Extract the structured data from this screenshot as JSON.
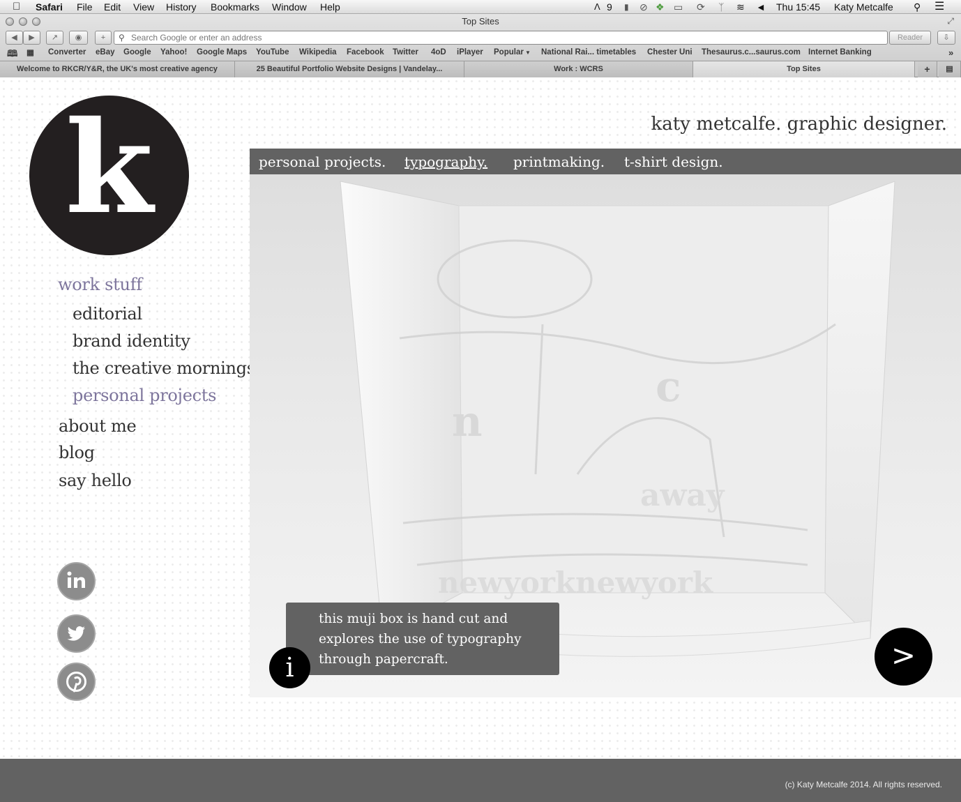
{
  "menubar": {
    "app": "Safari",
    "menus": [
      "File",
      "Edit",
      "View",
      "History",
      "Bookmarks",
      "Window",
      "Help"
    ],
    "status_count": "9",
    "clock": "Thu 15:45",
    "user": "Katy Metcalfe"
  },
  "window": {
    "title": "Top Sites"
  },
  "toolbar": {
    "address_placeholder": "Search Google or enter an address",
    "reader_label": "Reader"
  },
  "bookmarks": [
    "Converter",
    "eBay",
    "Google",
    "Yahoo!",
    "Google Maps",
    "YouTube",
    "Wikipedia",
    "Facebook",
    "Twitter",
    "4oD",
    "iPlayer",
    "Popular",
    "National Rai... timetables",
    "Chester Uni",
    "Thesaurus.c...saurus.com",
    "Internet Banking"
  ],
  "tabs": [
    {
      "label": "Welcome to RKCR/Y&R, the UK's most creative agency"
    },
    {
      "label": "25 Beautiful Portfolio Website Designs | Vandelay..."
    },
    {
      "label": "Work : WCRS"
    },
    {
      "label": "Top Sites"
    }
  ],
  "site": {
    "logo_letter": "k",
    "tagline": "katy metcalfe. graphic designer.",
    "nav": {
      "work_stuff": "work stuff",
      "editorial": "editorial",
      "brand_identity": "brand identity",
      "creative_mornings": "the creative mornings",
      "personal_projects": "personal projects",
      "about_me": "about me",
      "blog": "blog",
      "say_hello": "say hello"
    },
    "topnav": [
      "personal projects.",
      "typography.",
      "printmaking.",
      "t-shirt design."
    ],
    "caption": "this muji box is hand cut and explores the use of typography through papercraft.",
    "info_glyph": "i",
    "next_glyph": ">",
    "footer": "(c) Katy Metcalfe 2014. All rights reserved.",
    "colors": {
      "accent_purple": "#7d759c",
      "bar_gray": "#626262",
      "logo_black": "#231f20"
    }
  }
}
